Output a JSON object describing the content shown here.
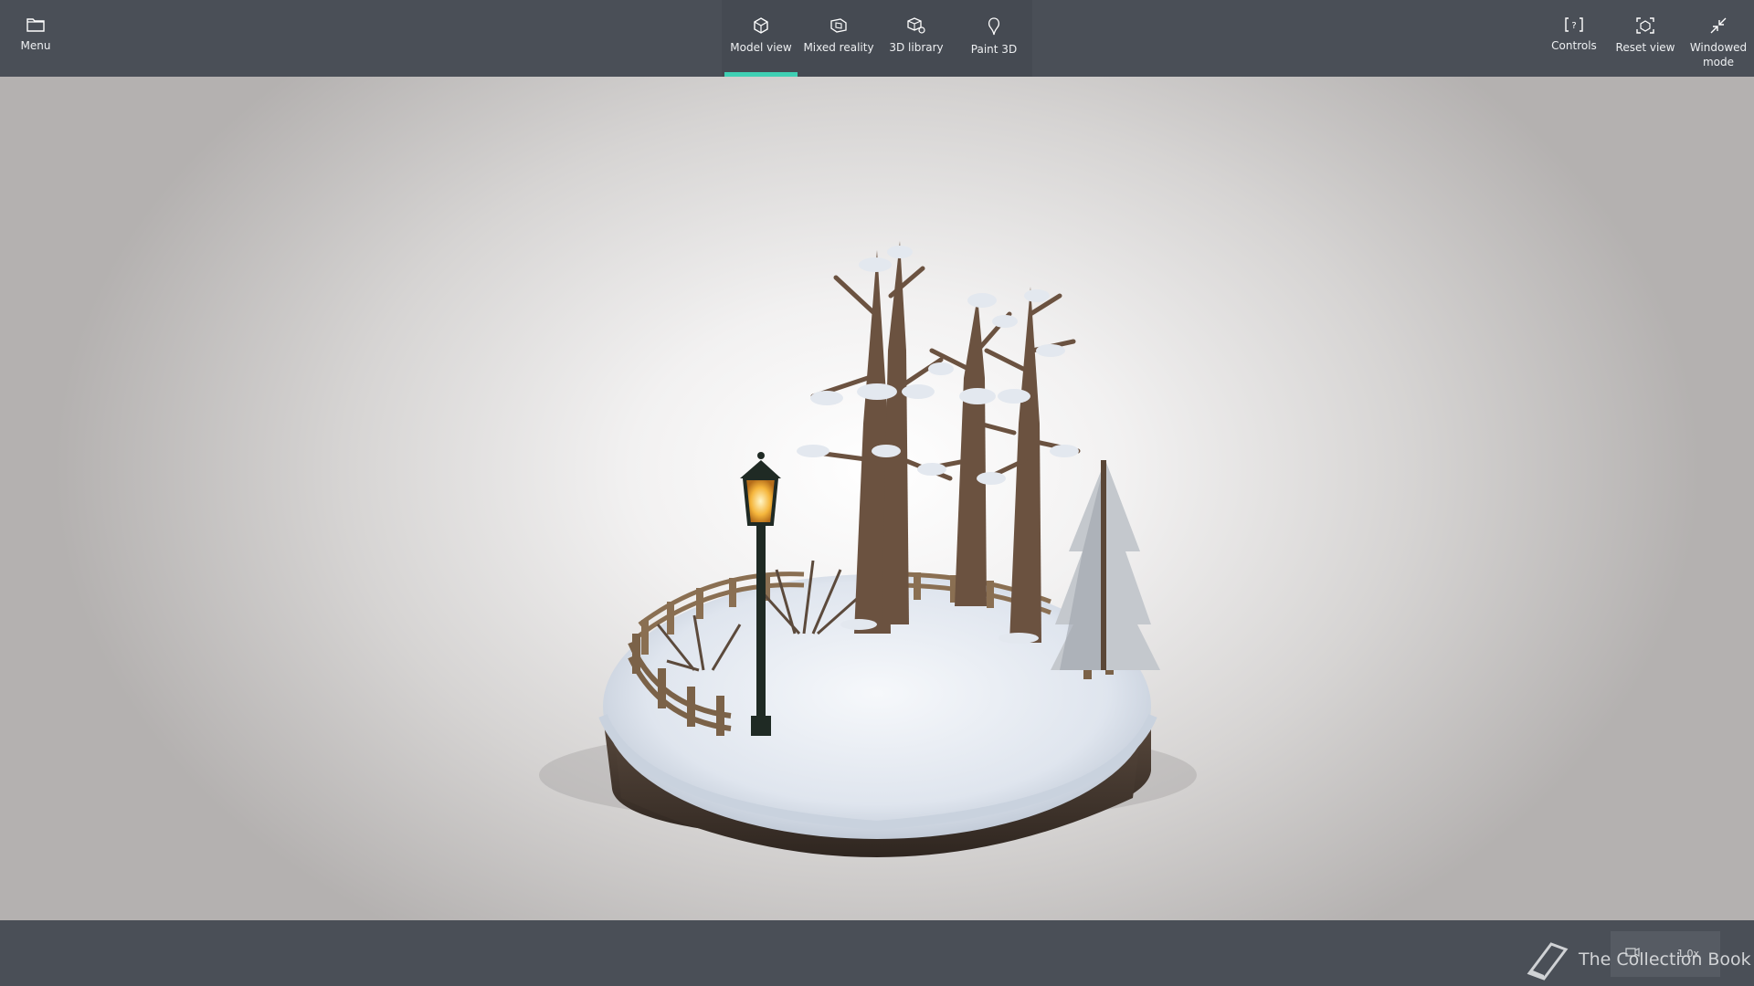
{
  "toolbar": {
    "menu_label": "Menu",
    "tabs": [
      {
        "label": "Model view",
        "icon": "cube-icon",
        "active": true
      },
      {
        "label": "Mixed reality",
        "icon": "mixed-reality-icon",
        "active": false
      },
      {
        "label": "3D library",
        "icon": "3d-library-icon",
        "active": false
      },
      {
        "label": "Paint 3D",
        "icon": "paint-3d-icon",
        "active": false
      }
    ],
    "controls_label": "Controls",
    "reset_view_label": "Reset view",
    "windowed_mode_label": "Windowed\nmode"
  },
  "status": {
    "zoom": "1.0x"
  },
  "watermark": "The Collection Book",
  "colors": {
    "bar": "#4a4f57",
    "accent": "#3fd0b4",
    "snow": "#e9edf3",
    "soil": "#4a3b30",
    "bark": "#6b5240"
  }
}
